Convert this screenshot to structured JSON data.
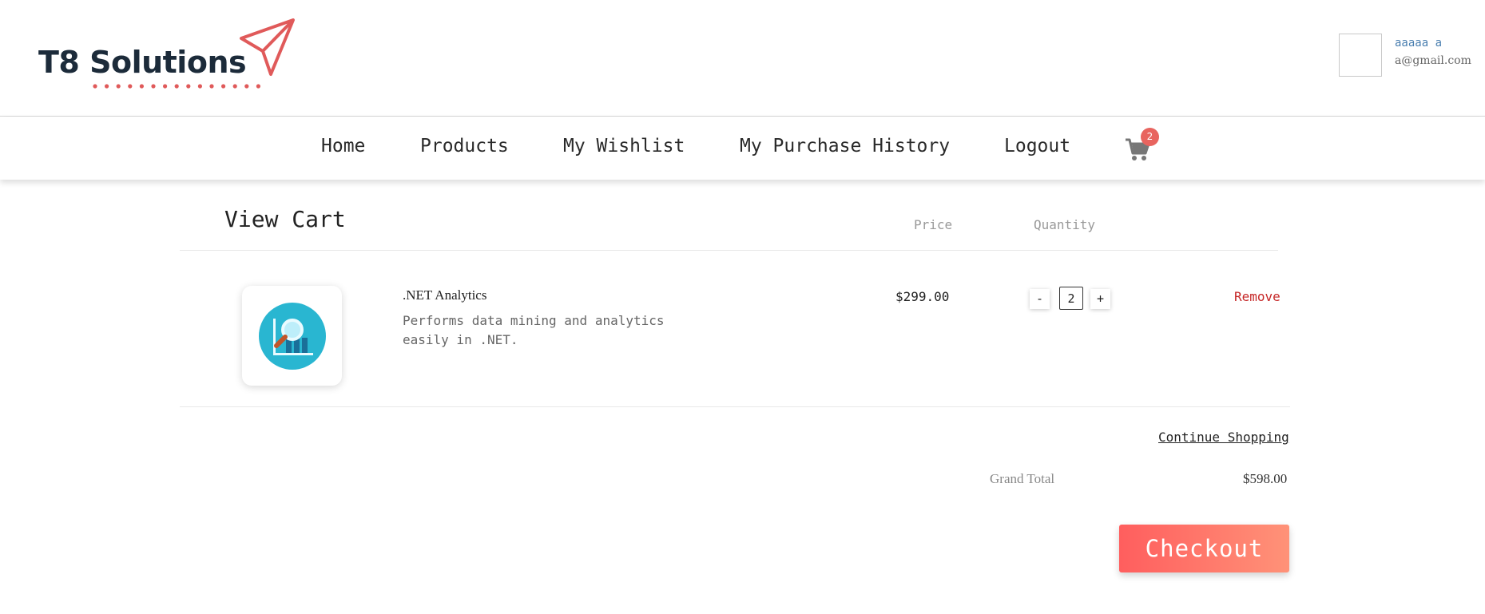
{
  "brand": {
    "name": "T8 Solutions",
    "accent": "#e05a5a",
    "dark": "#1c2b3a"
  },
  "user": {
    "name": "aaaaa a",
    "email": "a@gmail.com"
  },
  "nav": {
    "items": [
      "Home",
      "Products",
      "My Wishlist",
      "My Purchase History",
      "Logout"
    ],
    "cart_icon": "shopping-cart-icon",
    "cart_count": "2"
  },
  "cart": {
    "title": "View Cart",
    "columns": {
      "price": "Price",
      "quantity": "Quantity"
    },
    "items": [
      {
        "name": ".NET Analytics",
        "description": "Performs data mining and analytics easily in .NET.",
        "price": "$299.00",
        "quantity": "2",
        "decrement": "-",
        "increment": "+",
        "remove": "Remove",
        "icon": "analytics-magnifier-icon"
      }
    ],
    "continue_shopping": "Continue Shopping",
    "grand_total_label": "Grand Total",
    "grand_total_value": "$598.00",
    "checkout": "Checkout"
  },
  "colors": {
    "remove": "#c62828",
    "badge": "#e8645f",
    "checkout_start": "#ff5e5e",
    "checkout_end": "#ff9278",
    "product_icon": "#29b6d1"
  }
}
